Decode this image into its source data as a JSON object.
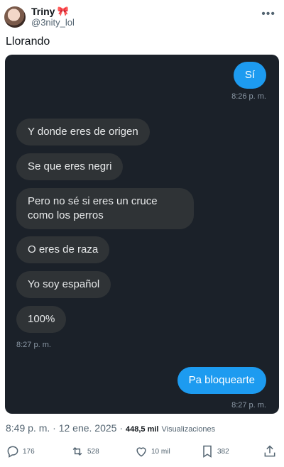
{
  "user": {
    "name": "Triny",
    "handle": "@3nity_lol"
  },
  "tweet": {
    "text": "Llorando"
  },
  "chat": {
    "out_1": "Sí",
    "time_1": "8:26 p. m.",
    "in_1": "Y donde eres de origen",
    "in_2": "Se que eres negri",
    "in_3": "Pero no sé si eres un cruce como los perros",
    "in_4": "O eres de raza",
    "in_5": "Yo soy español",
    "in_6": "100%",
    "time_2": "8:27 p. m.",
    "out_2": "Pa bloquearte",
    "time_3": "8:27 p. m."
  },
  "meta": {
    "datetime": "8:49 p. m. · 12 ene. 2025 ·",
    "views_count": "448,5 mil",
    "views_label": "Visualizaciones"
  },
  "actions": {
    "replies": "176",
    "reposts": "528",
    "likes": "10 mil",
    "bookmarks": "382"
  },
  "icons": {
    "bow": "ribbon-bow-emoji",
    "more": "more-horizontal-icon",
    "reply": "reply-icon",
    "repost": "repost-icon",
    "like": "heart-icon",
    "bookmark": "bookmark-icon",
    "share": "share-icon"
  },
  "colors": {
    "chat_bg": "#1b2129",
    "incoming_bubble": "#2f3336",
    "outgoing_bubble": "#1d9bf0",
    "secondary_text": "#536471"
  }
}
